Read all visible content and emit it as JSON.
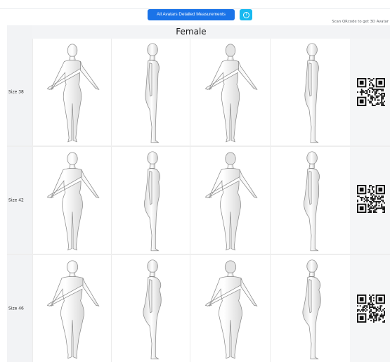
{
  "header": {
    "main_button_label": "All Avatars Detailed Measurements",
    "info_icon": "info-icon",
    "scan_note": "Scan QRcode to get 3D Avatar"
  },
  "table": {
    "title": "Female",
    "rows": [
      {
        "label": "Size 38",
        "build": 0.0
      },
      {
        "label": "Size 42",
        "build": 0.4
      },
      {
        "label": "Size 46",
        "build": 0.85
      }
    ],
    "views": [
      "front",
      "side-left",
      "back",
      "side-right"
    ]
  },
  "colors": {
    "primary": "#1a73e8",
    "info": "#18b9f0"
  }
}
